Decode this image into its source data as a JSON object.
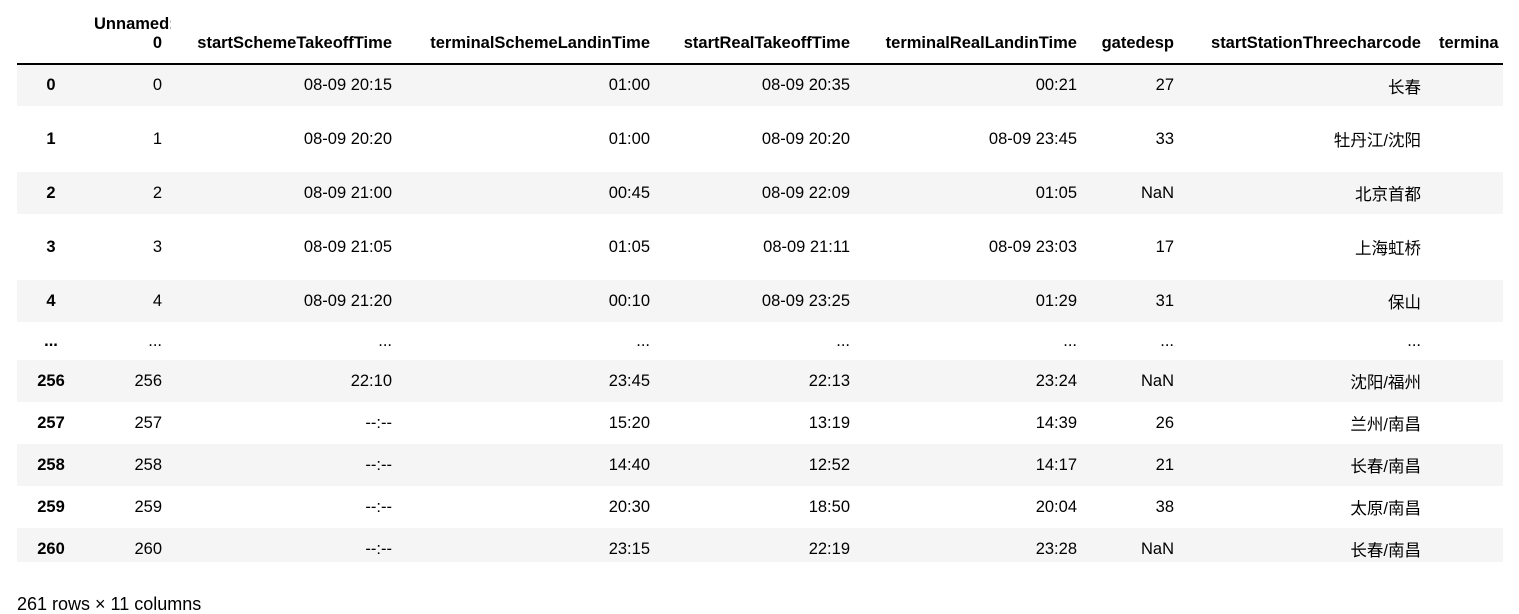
{
  "table": {
    "columns": [
      "",
      "Unnamed: 0",
      "startSchemeTakeoffTime",
      "terminalSchemeLandinTime",
      "startRealTakeoffTime",
      "terminalRealLandinTime",
      "gatedesp",
      "startStationThreecharcode",
      "termina"
    ],
    "rows": [
      [
        "0",
        "0",
        "08-09 20:15",
        "01:00",
        "08-09 20:35",
        "00:21",
        "27",
        "长春",
        ""
      ],
      [
        "1",
        "1",
        "08-09 20:20",
        "01:00",
        "08-09 20:20",
        "08-09 23:45",
        "33",
        "牡丹江/沈阳",
        ""
      ],
      [
        "2",
        "2",
        "08-09 21:00",
        "00:45",
        "08-09 22:09",
        "01:05",
        "NaN",
        "北京首都",
        ""
      ],
      [
        "3",
        "3",
        "08-09 21:05",
        "01:05",
        "08-09 21:11",
        "08-09 23:03",
        "17",
        "上海虹桥",
        ""
      ],
      [
        "4",
        "4",
        "08-09 21:20",
        "00:10",
        "08-09 23:25",
        "01:29",
        "31",
        "保山",
        ""
      ],
      [
        "...",
        "...",
        "...",
        "...",
        "...",
        "...",
        "...",
        "...",
        ""
      ],
      [
        "256",
        "256",
        "22:10",
        "23:45",
        "22:13",
        "23:24",
        "NaN",
        "沈阳/福州",
        ""
      ],
      [
        "257",
        "257",
        "--:--",
        "15:20",
        "13:19",
        "14:39",
        "26",
        "兰州/南昌",
        ""
      ],
      [
        "258",
        "258",
        "--:--",
        "14:40",
        "12:52",
        "14:17",
        "21",
        "长春/南昌",
        ""
      ],
      [
        "259",
        "259",
        "--:--",
        "20:30",
        "18:50",
        "20:04",
        "38",
        "太原/南昌",
        ""
      ],
      [
        "260",
        "260",
        "--:--",
        "23:15",
        "22:19",
        "23:28",
        "NaN",
        "长春/南昌",
        ""
      ]
    ]
  },
  "footer": "261 rows × 11 columns"
}
